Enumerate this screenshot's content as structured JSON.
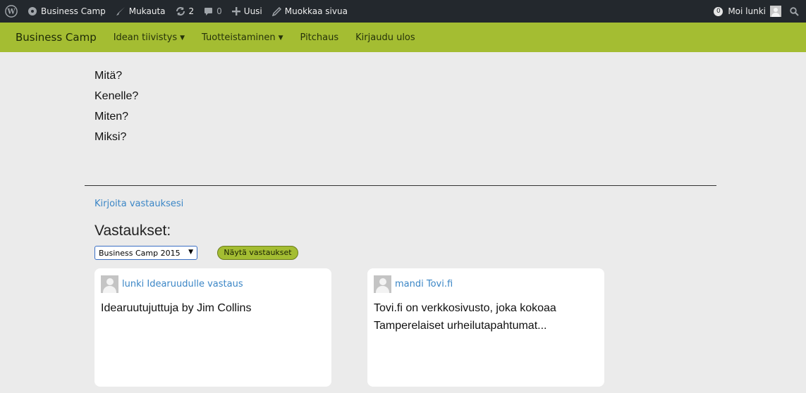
{
  "adminbar": {
    "site_name": "Business Camp",
    "customize": "Mukauta",
    "updates_count": "2",
    "comments_count": "0",
    "new_label": "Uusi",
    "edit_label": "Muokkaa sivua",
    "notif_count": "0",
    "greeting": "Moi lunki"
  },
  "nav": {
    "brand": "Business Camp",
    "items": [
      "Idean tiivistys",
      "Tuotteistaminen",
      "Pitchaus",
      "Kirjaudu ulos"
    ]
  },
  "questions": [
    "Mitä?",
    "Kenelle?",
    "Miten?",
    "Miksi?"
  ],
  "write_link": "Kirjoita vastauksesi",
  "answers_title": "Vastaukset:",
  "select_value": "Business Camp 2015",
  "show_button": "Näytä vastaukset",
  "cards": [
    {
      "author": "lunki Idearuudulle vastaus",
      "text": "Idearuutujuttuja by Jim Collins"
    },
    {
      "author": "mandi Tovi.fi",
      "text": "Tovi.fi on verkkosivusto, joka kokoaa Tamperelaiset urheilutapahtumat..."
    }
  ],
  "colors": {
    "adminbar": "#23282d",
    "nav": "#a4bd32",
    "link": "#3b86c6",
    "page_bg": "#ebebeb"
  }
}
